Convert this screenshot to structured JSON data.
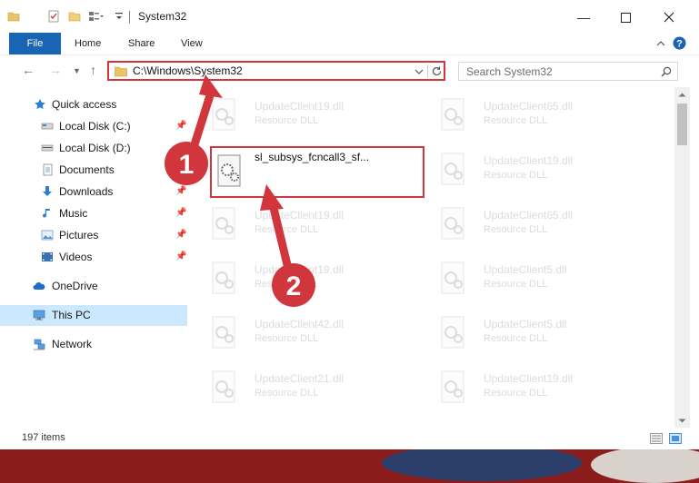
{
  "window": {
    "title": "System32"
  },
  "ribbon": {
    "tabs": [
      "File",
      "Home",
      "Share",
      "View"
    ]
  },
  "address_bar": {
    "path": "C:\\Windows\\System32"
  },
  "search": {
    "placeholder": "Search System32"
  },
  "navigation": {
    "items": [
      {
        "label": "Quick access",
        "icon": "star-icon"
      },
      {
        "label": "Local Disk (C:)",
        "icon": "drive-icon",
        "pinned": true
      },
      {
        "label": "Local Disk (D:)",
        "icon": "drive-icon"
      },
      {
        "label": "Documents",
        "icon": "document-icon",
        "pinned": true
      },
      {
        "label": "Downloads",
        "icon": "download-icon",
        "pinned": true
      },
      {
        "label": "Music",
        "icon": "music-icon",
        "pinned": true
      },
      {
        "label": "Pictures",
        "icon": "picture-icon",
        "pinned": true
      },
      {
        "label": "Videos",
        "icon": "video-icon",
        "pinned": true
      },
      {
        "label": "OneDrive",
        "icon": "cloud-icon"
      },
      {
        "label": "This PC",
        "icon": "computer-icon",
        "selected": true
      },
      {
        "label": "Network",
        "icon": "network-icon"
      }
    ]
  },
  "files": {
    "target": {
      "name": "sl_subsys_fcncall3_sf...",
      "type": ""
    },
    "ghosts": [
      {
        "name": "UpdateClient19.dll",
        "type": "Resource DLL"
      },
      {
        "name": "UpdateClient65.dll",
        "type": "Resource DLL"
      },
      {
        "name": "UpdateClient19.dll",
        "type": "Resource DLL"
      },
      {
        "name": "UpdateClient65.dll",
        "type": "Resource DLL"
      },
      {
        "name": "UpdateClient19.dll",
        "type": "Resource DLL"
      },
      {
        "name": "UpdateClient65.dll",
        "type": "Resource DLL"
      },
      {
        "name": "UpdateClient5.dll",
        "type": "Resource DLL"
      },
      {
        "name": "UpdateClient42.dll",
        "type": "Resource DLL"
      },
      {
        "name": "UpdateClient5.dll",
        "type": "Resource DLL"
      },
      {
        "name": "UpdateClient21.dll",
        "type": "Resource DLL"
      },
      {
        "name": "UpdateClient19.dll",
        "type": "Resource DLL"
      }
    ]
  },
  "status": {
    "item_count": "197 items"
  },
  "annotations": {
    "step1": "1",
    "step2": "2"
  },
  "colors": {
    "accent": "#1a64b4",
    "highlight": "#d0363c",
    "selected": "#cce8ff"
  }
}
